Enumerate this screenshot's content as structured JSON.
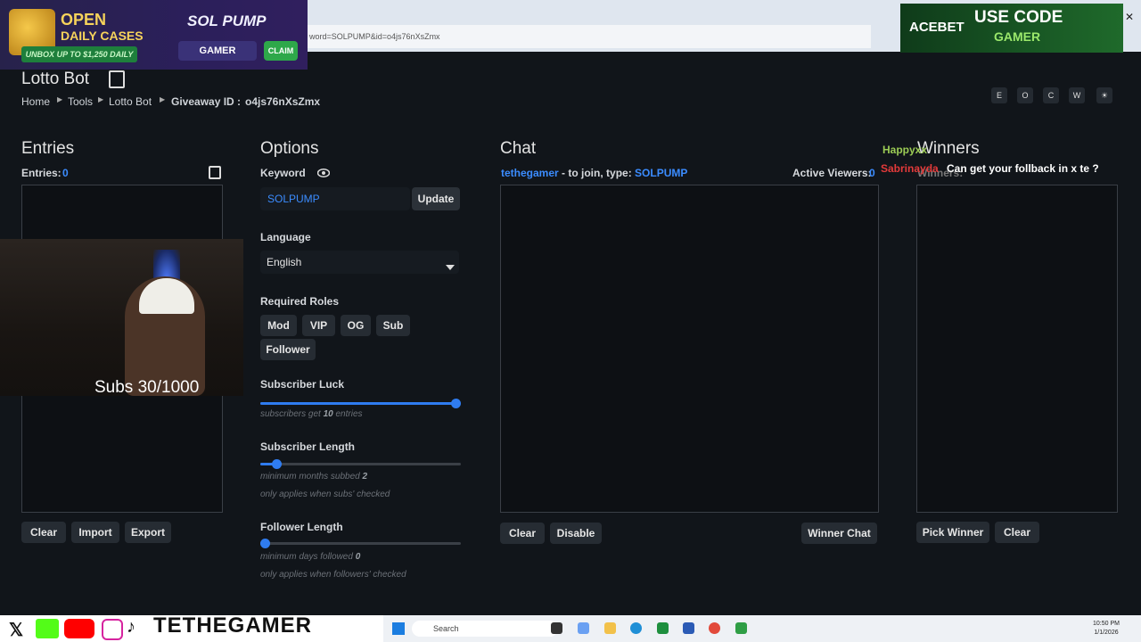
{
  "browser": {
    "url": "word=SOLPUMP&id=o4js76nXsZmx",
    "close": "✕"
  },
  "banner": {
    "open": "OPEN",
    "daily": "DAILY CASES",
    "unbox": "UNBOX UP TO $1,250 DAILY",
    "logo": "SOL PUMP",
    "code": "GAMER",
    "claim": "CLAIM"
  },
  "acebet": {
    "logo": "ACEBET",
    "use_code": "USE CODE",
    "code": "GAMER"
  },
  "header": {
    "title": "Lotto Bot",
    "breadcrumb": [
      "Home",
      "Tools",
      "Lotto Bot"
    ],
    "giveaway_label": "Giveaway ID :",
    "giveaway_id": "o4js76nXsZmx",
    "buttons": [
      "E",
      "O",
      "C",
      "W",
      "☀"
    ]
  },
  "entries": {
    "title": "Entries",
    "count_label": "Entries:",
    "count": "0",
    "buttons": [
      "Clear",
      "Import",
      "Export"
    ]
  },
  "options": {
    "title": "Options",
    "keyword_label": "Keyword",
    "keyword_value": "SOLPUMP",
    "update": "Update",
    "language_label": "Language",
    "language_value": "English",
    "roles_label": "Required Roles",
    "roles": [
      "Mod",
      "VIP",
      "OG",
      "Sub",
      "Follower"
    ],
    "sub_luck_label": "Subscriber Luck",
    "sub_luck_hint_pre": "subscribers get",
    "sub_luck_value": "10",
    "sub_luck_hint_post": "entries",
    "sub_luck_level": 1.0,
    "sub_len_label": "Subscriber Length",
    "sub_len_hint_pre": "minimum months subbed",
    "sub_len_value": "2",
    "sub_len_note": "only applies when subs' checked",
    "sub_len_level": 0.06,
    "fol_len_label": "Follower Length",
    "fol_len_hint_pre": "minimum days followed",
    "fol_len_value": "0",
    "fol_len_note": "only applies when followers' checked",
    "fol_len_level": 0.0
  },
  "chat": {
    "title": "Chat",
    "user": "tethegamer",
    "join_text": "- to join, type:",
    "join_keyword": "SOLPUMP",
    "viewers_label": "Active Viewers:",
    "viewers": "0",
    "buttons": [
      "Clear",
      "Disable",
      "Winner Chat"
    ]
  },
  "winners": {
    "title": "Winners",
    "count_label": "Winners:",
    "buttons": [
      "Pick Winner",
      "Clear"
    ]
  },
  "overlay_chat": {
    "name1": "Happyxx",
    "name2": "Sabrinayda",
    "message": "Can get your follback in x te ?"
  },
  "webcam": {
    "subs": "Subs 30/1000"
  },
  "social": {
    "handle": "TETHEGAMER"
  },
  "taskbar": {
    "search": "Search",
    "time": "10:50 PM",
    "date": "1/1/2026"
  },
  "colors": {
    "accent": "#2f7cf0",
    "link": "#3b8cff",
    "bg": "#11151a"
  }
}
